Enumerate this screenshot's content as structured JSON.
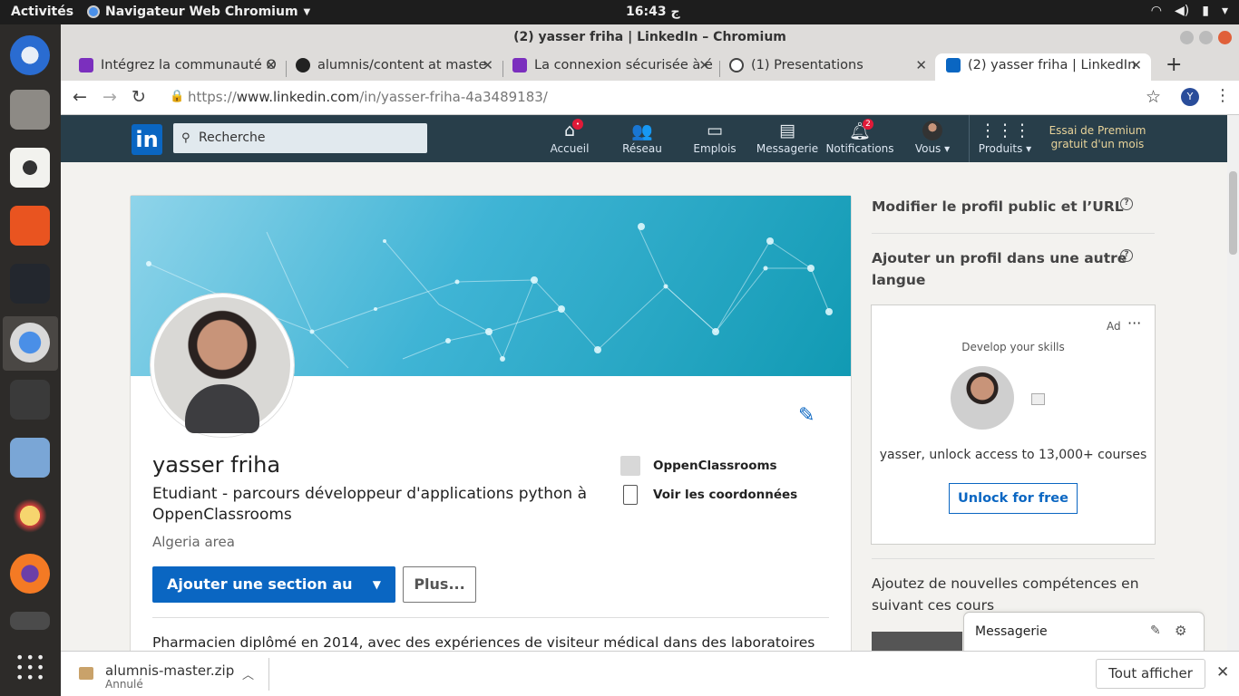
{
  "os": {
    "activities": "Activités",
    "app_name": "Navigateur Web Chromium",
    "clock": "16:43 ج",
    "tray": {
      "wifi": "wifi-icon",
      "volume": "volume-icon",
      "battery": "battery-icon",
      "power": "power-icon"
    }
  },
  "window": {
    "title": "(2) yasser friha | LinkedIn – Chromium"
  },
  "tabs": [
    {
      "label": "Intégrez la communauté O",
      "favicon_color": "#7b2fbe"
    },
    {
      "label": "alumnis/content at maste",
      "favicon_color": "#222222"
    },
    {
      "label": "La connexion sécurisée à é",
      "favicon_color": "#7b2fbe"
    },
    {
      "label": "(1) Presentations",
      "favicon_color": "#444444"
    },
    {
      "label": "(2) yasser friha | LinkedIn",
      "favicon_color": "#0a66c2"
    }
  ],
  "address": {
    "scheme": "https://",
    "host": "www.linkedin.com",
    "path": "/in/yasser-friha-4a3489183/",
    "profile_initial": "Y"
  },
  "linkedin_nav": {
    "logo": "in",
    "search_placeholder": "Recherche",
    "items": [
      {
        "label": "Accueil",
        "icon": "home-icon",
        "badge": "•"
      },
      {
        "label": "Réseau",
        "icon": "network-icon"
      },
      {
        "label": "Emplois",
        "icon": "briefcase-icon"
      },
      {
        "label": "Messagerie",
        "icon": "messaging-icon"
      },
      {
        "label": "Notifications",
        "icon": "bell-icon",
        "badge": "2"
      },
      {
        "label": "Vous ▾",
        "icon": "avatar-icon"
      },
      {
        "label": "Produits ▾",
        "icon": "grid-icon"
      }
    ],
    "premium_line1": "Essai de Premium",
    "premium_line2": "gratuit d'un mois"
  },
  "profile": {
    "name": "yasser friha",
    "headline": "Etudiant - parcours développeur d'applications python à OppenClassrooms",
    "location": "Algeria area",
    "company": "OppenClassrooms",
    "contact": "Voir les coordonnées",
    "add_section": "Ajouter une section au profil",
    "more": "Plus...",
    "summary": "Pharmacien diplômé en 2014, avec des expériences de visiteur médical dans des laboratoires"
  },
  "right_rail": {
    "edit_public": "Modifier le profil public et l’URL",
    "add_language_line1": "Ajouter un profil dans une autre",
    "add_language_line2": "langue",
    "ad": {
      "label": "Ad",
      "tagline": "Develop your skills",
      "message": "yasser, unlock access to 13,000+ courses",
      "cta": "Unlock for free"
    },
    "courses_line1": "Ajoutez de nouvelles compétences en",
    "courses_line2": "suivant ces cours"
  },
  "messaging": {
    "label": "Messagerie"
  },
  "downloads": {
    "file": "alumnis-master.zip",
    "status": "Annulé",
    "show_all": "Tout afficher"
  }
}
